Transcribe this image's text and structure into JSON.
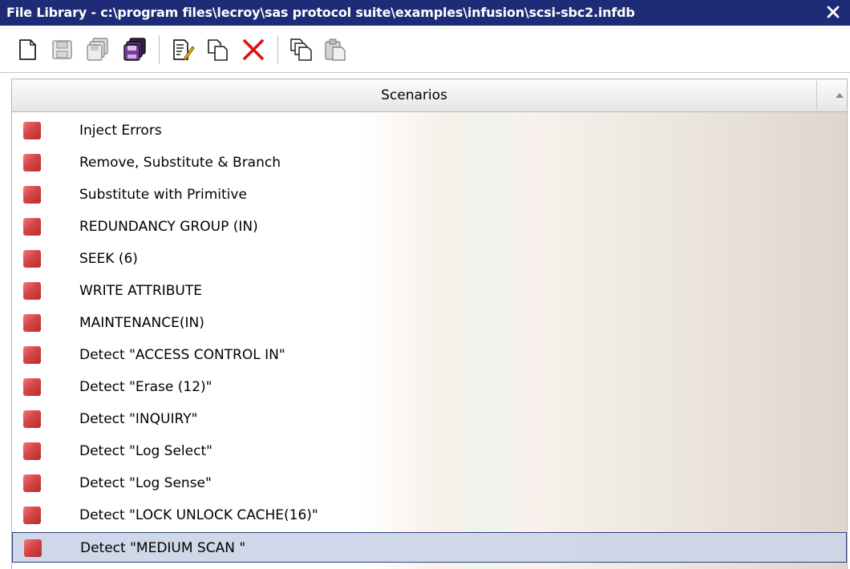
{
  "window": {
    "title": "File Library - c:\\program files\\lecroy\\sas protocol suite\\examples\\infusion\\scsi-sbc2.infdb",
    "close_label": "×"
  },
  "toolbar": {
    "buttons": [
      "new-file-icon",
      "save-icon",
      "save-all-icon",
      "save-as-icon",
      "edit-icon",
      "copy-icon",
      "delete-icon",
      "duplicate-icon",
      "paste-icon"
    ]
  },
  "table": {
    "header": "Scenarios",
    "sort": "ascending",
    "rows": [
      {
        "label": "Inject Errors"
      },
      {
        "label": "Remove, Substitute & Branch"
      },
      {
        "label": "Substitute with Primitive"
      },
      {
        "label": "REDUNDANCY GROUP (IN)"
      },
      {
        "label": "SEEK (6)"
      },
      {
        "label": "WRITE ATTRIBUTE"
      },
      {
        "label": "MAINTENANCE(IN)"
      },
      {
        "label": "Detect \"ACCESS CONTROL IN\""
      },
      {
        "label": "Detect \"Erase (12)\""
      },
      {
        "label": "Detect \"INQUIRY\""
      },
      {
        "label": "Detect \"Log Select\""
      },
      {
        "label": "Detect \"Log Sense\""
      },
      {
        "label": "Detect \"LOCK UNLOCK CACHE(16)\""
      },
      {
        "label": "Detect \"MEDIUM SCAN \""
      }
    ],
    "selected_index": 13
  },
  "colors": {
    "titlebar": "#1e2c78",
    "row_icon": "#d64545",
    "delete_icon": "#e01010"
  }
}
